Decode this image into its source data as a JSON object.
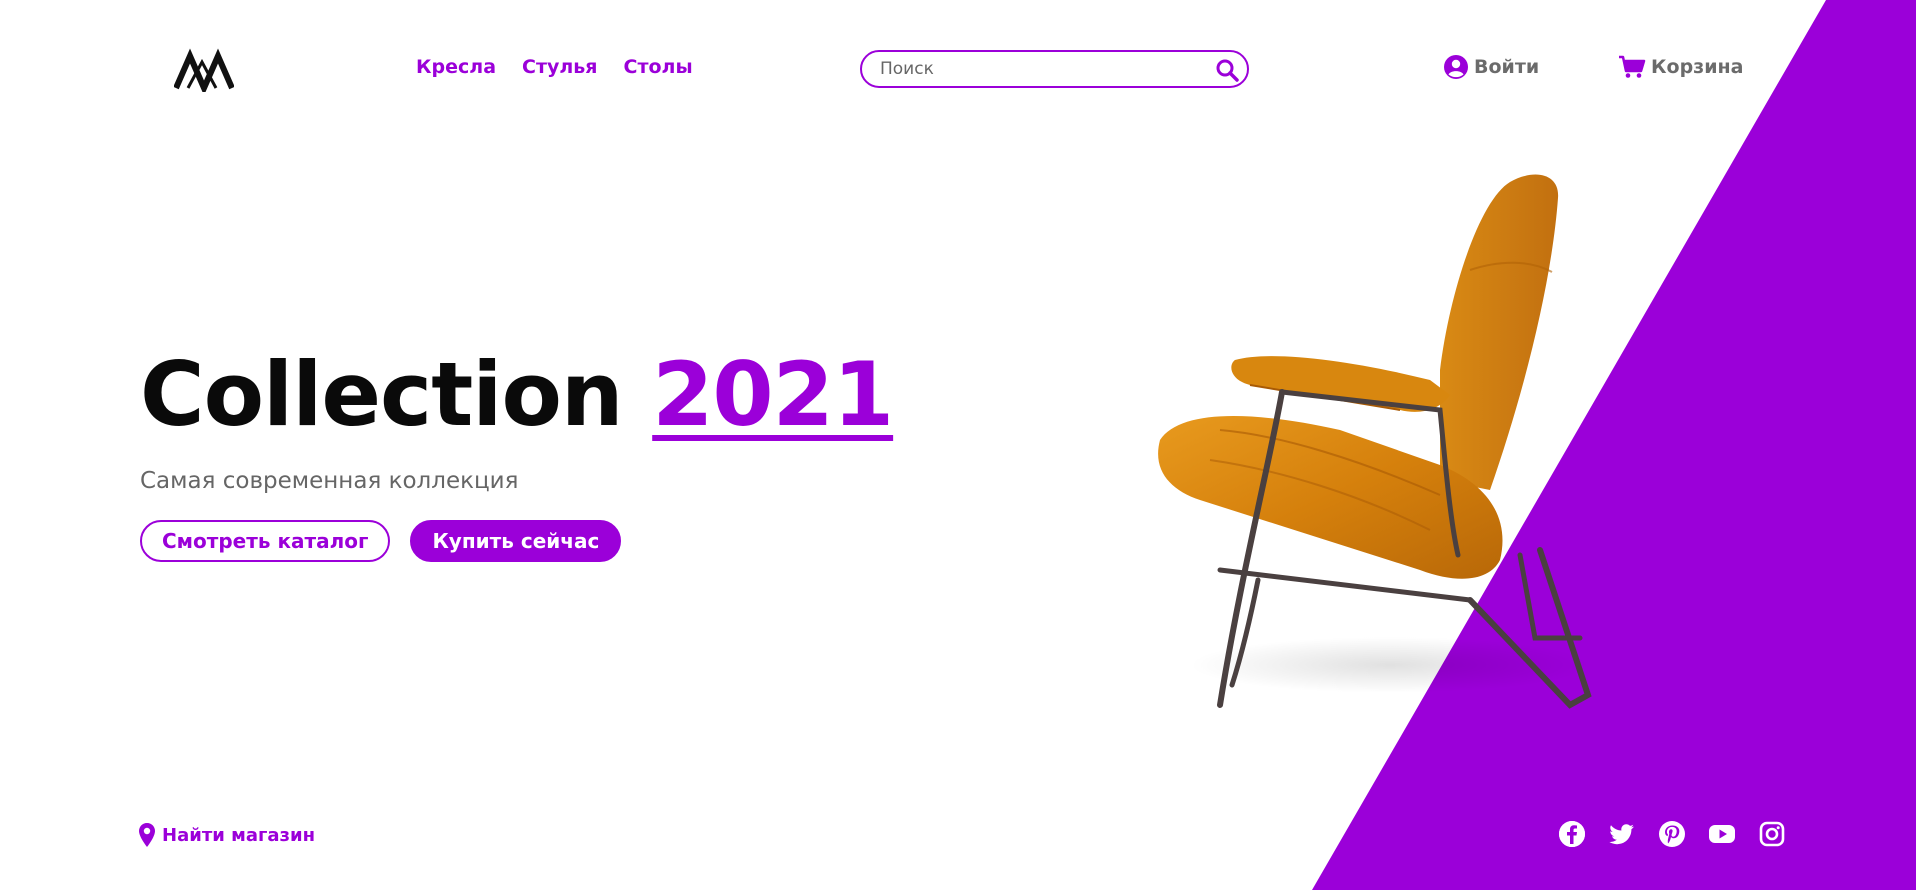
{
  "header": {
    "nav": [
      {
        "label": "Кресла"
      },
      {
        "label": "Стулья"
      },
      {
        "label": "Столы"
      }
    ],
    "search": {
      "placeholder": "Поиск",
      "icon": "search-icon"
    },
    "login": {
      "label": "Войти",
      "icon": "user-circle-icon"
    },
    "cart": {
      "label": "Корзина",
      "icon": "cart-icon"
    }
  },
  "hero": {
    "title": "Collection",
    "year": "2021",
    "subtitle": "Самая современная коллекция",
    "catalog_button": "Смотреть каталог",
    "buy_button": "Купить сейчас"
  },
  "footer": {
    "find_store": "Найти магазин",
    "social": [
      "facebook-icon",
      "twitter-icon",
      "pinterest-icon",
      "youtube-icon",
      "instagram-icon"
    ]
  },
  "colors": {
    "accent": "#9b00d9",
    "text_dark": "#0a0a0a",
    "text_muted": "#666666",
    "chair": "#d9820f"
  }
}
